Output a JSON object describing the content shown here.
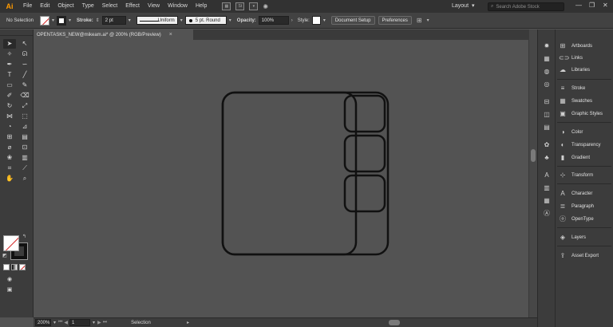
{
  "app": {
    "logo": "Ai",
    "accent_color": "#ff9a00"
  },
  "menu": [
    "File",
    "Edit",
    "Object",
    "Type",
    "Select",
    "Effect",
    "View",
    "Window",
    "Help"
  ],
  "workspace": {
    "label": "Layout"
  },
  "search": {
    "placeholder": "Search Adobe Stock"
  },
  "control_bar": {
    "selection_label": "No Selection",
    "stroke_label": "Stroke:",
    "stroke_weight": "2 pt",
    "profile": "Uniform",
    "brush": "5 pt. Round",
    "opacity_label": "Opacity:",
    "opacity_value": "100%",
    "style_label": "Style:",
    "doc_setup": "Document Setup",
    "preferences": "Preferences"
  },
  "document_tab": {
    "title": "OPENTASKS_NEW@mikeam.ai* @ 200% (RGB/Preview)",
    "close": "×"
  },
  "panels": [
    {
      "label": "Artboards",
      "icon": "artboards-icon"
    },
    {
      "label": "Links",
      "icon": "links-icon"
    },
    {
      "label": "Libraries",
      "icon": "libraries-icon"
    },
    {
      "label": "Stroke",
      "icon": "stroke-icon"
    },
    {
      "label": "Swatches",
      "icon": "swatches-icon"
    },
    {
      "label": "Graphic Styles",
      "icon": "graphic-styles-icon"
    },
    {
      "label": "Color",
      "icon": "color-icon"
    },
    {
      "label": "Transparency",
      "icon": "transparency-icon"
    },
    {
      "label": "Gradient",
      "icon": "gradient-icon"
    },
    {
      "label": "Transform",
      "icon": "transform-icon"
    },
    {
      "label": "Character",
      "icon": "character-icon"
    },
    {
      "label": "Paragraph",
      "icon": "paragraph-icon"
    },
    {
      "label": "OpenType",
      "icon": "opentype-icon"
    },
    {
      "label": "Layers",
      "icon": "layers-icon"
    },
    {
      "label": "Asset Export",
      "icon": "asset-export-icon"
    }
  ],
  "status_bar": {
    "zoom": "200%",
    "artboard_number": "1",
    "tool": "Selection"
  }
}
